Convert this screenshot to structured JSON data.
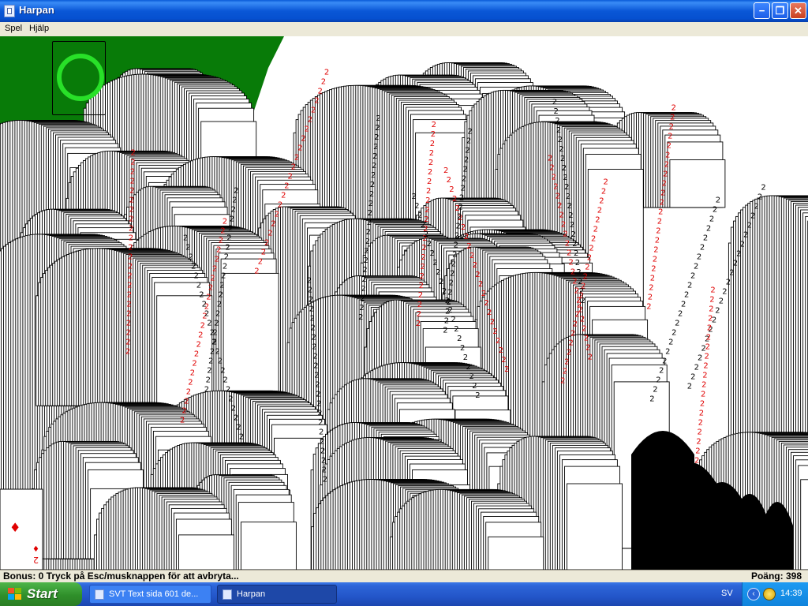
{
  "window": {
    "title": "Harpan",
    "buttons": {
      "minimize": "−",
      "maximize": "❐",
      "close": "✕"
    }
  },
  "menu": {
    "items": [
      "Spel",
      "Hjälp"
    ]
  },
  "game": {
    "felt_color": "#087b08",
    "deck_ring_color": "#28e028",
    "card_rank": "2",
    "card_suit_heart": "♥",
    "card_suit_diamond": "♦"
  },
  "status": {
    "left": "Bonus: 0  Tryck på Esc/musknappen för att avbryta...",
    "right": "Poäng: 398"
  },
  "taskbar": {
    "start_label": "Start",
    "tasks": [
      {
        "label": "SVT Text sida 601 de...",
        "active": false
      },
      {
        "label": "Harpan",
        "active": true
      }
    ],
    "language": "SV",
    "tray_arrow": "‹",
    "clock": "14:39"
  }
}
